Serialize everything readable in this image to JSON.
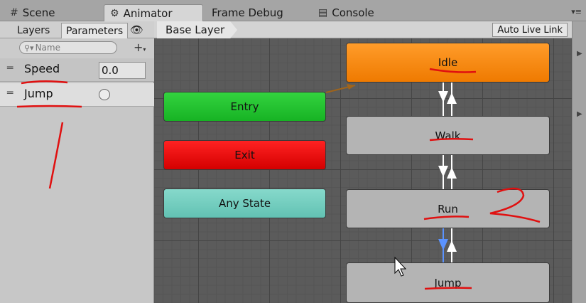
{
  "tabs": [
    {
      "label": "Scene",
      "icon": "grid-icon"
    },
    {
      "label": "Animator",
      "icon": "animator-icon"
    },
    {
      "label": "Frame Debug",
      "icon": ""
    },
    {
      "label": "Console",
      "icon": "console-icon"
    }
  ],
  "left_panel": {
    "tabs": [
      "Layers",
      "Parameters"
    ],
    "search_placeholder": "Name",
    "parameters": [
      {
        "name": "Speed",
        "value": "0.0"
      },
      {
        "name": "Jump"
      }
    ]
  },
  "graph": {
    "breadcrumb": "Base Layer",
    "live_link": "Auto Live Link",
    "states": {
      "entry": "Entry",
      "exit": "Exit",
      "any_state": "Any State",
      "idle": "Idle",
      "walk": "Walk",
      "run": "Run",
      "jump": "Jump"
    }
  },
  "colors": {
    "entry": "#2bc836",
    "exit": "#e60a0a",
    "any_state": "#74ccbe",
    "default_state": "#f58a0f",
    "annotation": "#e01010",
    "transition_selected": "#5b93ff"
  }
}
